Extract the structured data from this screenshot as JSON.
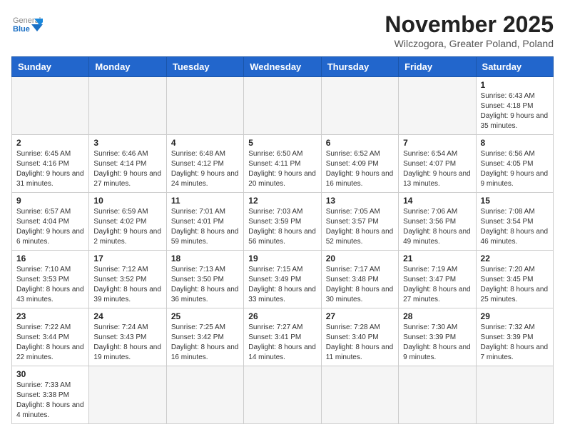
{
  "header": {
    "logo_general": "General",
    "logo_blue": "Blue",
    "month_title": "November 2025",
    "location": "Wilczogora, Greater Poland, Poland"
  },
  "weekdays": [
    "Sunday",
    "Monday",
    "Tuesday",
    "Wednesday",
    "Thursday",
    "Friday",
    "Saturday"
  ],
  "weeks": [
    [
      {
        "day": "",
        "info": ""
      },
      {
        "day": "",
        "info": ""
      },
      {
        "day": "",
        "info": ""
      },
      {
        "day": "",
        "info": ""
      },
      {
        "day": "",
        "info": ""
      },
      {
        "day": "",
        "info": ""
      },
      {
        "day": "1",
        "info": "Sunrise: 6:43 AM\nSunset: 4:18 PM\nDaylight: 9 hours\nand 35 minutes."
      }
    ],
    [
      {
        "day": "2",
        "info": "Sunrise: 6:45 AM\nSunset: 4:16 PM\nDaylight: 9 hours\nand 31 minutes."
      },
      {
        "day": "3",
        "info": "Sunrise: 6:46 AM\nSunset: 4:14 PM\nDaylight: 9 hours\nand 27 minutes."
      },
      {
        "day": "4",
        "info": "Sunrise: 6:48 AM\nSunset: 4:12 PM\nDaylight: 9 hours\nand 24 minutes."
      },
      {
        "day": "5",
        "info": "Sunrise: 6:50 AM\nSunset: 4:11 PM\nDaylight: 9 hours\nand 20 minutes."
      },
      {
        "day": "6",
        "info": "Sunrise: 6:52 AM\nSunset: 4:09 PM\nDaylight: 9 hours\nand 16 minutes."
      },
      {
        "day": "7",
        "info": "Sunrise: 6:54 AM\nSunset: 4:07 PM\nDaylight: 9 hours\nand 13 minutes."
      },
      {
        "day": "8",
        "info": "Sunrise: 6:56 AM\nSunset: 4:05 PM\nDaylight: 9 hours\nand 9 minutes."
      }
    ],
    [
      {
        "day": "9",
        "info": "Sunrise: 6:57 AM\nSunset: 4:04 PM\nDaylight: 9 hours\nand 6 minutes."
      },
      {
        "day": "10",
        "info": "Sunrise: 6:59 AM\nSunset: 4:02 PM\nDaylight: 9 hours\nand 2 minutes."
      },
      {
        "day": "11",
        "info": "Sunrise: 7:01 AM\nSunset: 4:01 PM\nDaylight: 8 hours\nand 59 minutes."
      },
      {
        "day": "12",
        "info": "Sunrise: 7:03 AM\nSunset: 3:59 PM\nDaylight: 8 hours\nand 56 minutes."
      },
      {
        "day": "13",
        "info": "Sunrise: 7:05 AM\nSunset: 3:57 PM\nDaylight: 8 hours\nand 52 minutes."
      },
      {
        "day": "14",
        "info": "Sunrise: 7:06 AM\nSunset: 3:56 PM\nDaylight: 8 hours\nand 49 minutes."
      },
      {
        "day": "15",
        "info": "Sunrise: 7:08 AM\nSunset: 3:54 PM\nDaylight: 8 hours\nand 46 minutes."
      }
    ],
    [
      {
        "day": "16",
        "info": "Sunrise: 7:10 AM\nSunset: 3:53 PM\nDaylight: 8 hours\nand 43 minutes."
      },
      {
        "day": "17",
        "info": "Sunrise: 7:12 AM\nSunset: 3:52 PM\nDaylight: 8 hours\nand 39 minutes."
      },
      {
        "day": "18",
        "info": "Sunrise: 7:13 AM\nSunset: 3:50 PM\nDaylight: 8 hours\nand 36 minutes."
      },
      {
        "day": "19",
        "info": "Sunrise: 7:15 AM\nSunset: 3:49 PM\nDaylight: 8 hours\nand 33 minutes."
      },
      {
        "day": "20",
        "info": "Sunrise: 7:17 AM\nSunset: 3:48 PM\nDaylight: 8 hours\nand 30 minutes."
      },
      {
        "day": "21",
        "info": "Sunrise: 7:19 AM\nSunset: 3:47 PM\nDaylight: 8 hours\nand 27 minutes."
      },
      {
        "day": "22",
        "info": "Sunrise: 7:20 AM\nSunset: 3:45 PM\nDaylight: 8 hours\nand 25 minutes."
      }
    ],
    [
      {
        "day": "23",
        "info": "Sunrise: 7:22 AM\nSunset: 3:44 PM\nDaylight: 8 hours\nand 22 minutes."
      },
      {
        "day": "24",
        "info": "Sunrise: 7:24 AM\nSunset: 3:43 PM\nDaylight: 8 hours\nand 19 minutes."
      },
      {
        "day": "25",
        "info": "Sunrise: 7:25 AM\nSunset: 3:42 PM\nDaylight: 8 hours\nand 16 minutes."
      },
      {
        "day": "26",
        "info": "Sunrise: 7:27 AM\nSunset: 3:41 PM\nDaylight: 8 hours\nand 14 minutes."
      },
      {
        "day": "27",
        "info": "Sunrise: 7:28 AM\nSunset: 3:40 PM\nDaylight: 8 hours\nand 11 minutes."
      },
      {
        "day": "28",
        "info": "Sunrise: 7:30 AM\nSunset: 3:39 PM\nDaylight: 8 hours\nand 9 minutes."
      },
      {
        "day": "29",
        "info": "Sunrise: 7:32 AM\nSunset: 3:39 PM\nDaylight: 8 hours\nand 7 minutes."
      }
    ],
    [
      {
        "day": "30",
        "info": "Sunrise: 7:33 AM\nSunset: 3:38 PM\nDaylight: 8 hours\nand 4 minutes."
      },
      {
        "day": "",
        "info": ""
      },
      {
        "day": "",
        "info": ""
      },
      {
        "day": "",
        "info": ""
      },
      {
        "day": "",
        "info": ""
      },
      {
        "day": "",
        "info": ""
      },
      {
        "day": "",
        "info": ""
      }
    ]
  ]
}
